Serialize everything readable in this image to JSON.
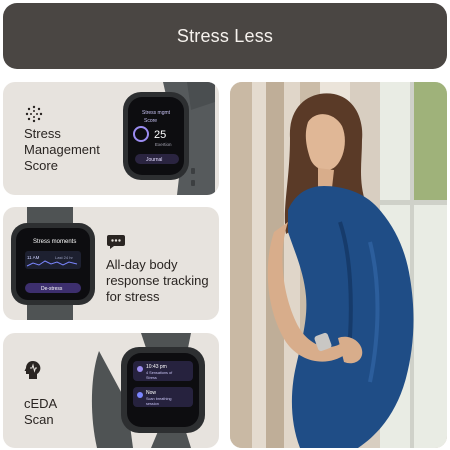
{
  "banner": {
    "title": "Stress Less"
  },
  "features": [
    {
      "label_lines": [
        "Stress",
        "Management",
        "Score"
      ],
      "icon": "dotted-circle-icon"
    },
    {
      "label_lines": [
        "All-day body",
        "response tracking",
        "for stress"
      ],
      "icon": "chat-bubble-icon"
    },
    {
      "label_lines": [
        "cEDA",
        "Scan"
      ],
      "icon": "head-pulse-icon"
    }
  ],
  "watch1": {
    "line1": "Stress mgmt",
    "line2": "Score",
    "score": "25",
    "sub": "Exertion",
    "button": "Journal"
  },
  "watch2": {
    "title": "Stress moments",
    "time": "11 AM",
    "range": "Last 24 hr",
    "button": "De-stress"
  },
  "watch3": {
    "time1": "10:43 pm",
    "sub1": "4 Sensations of",
    "sub2": "Stress",
    "time2": "Now",
    "sub3": "Scan breathing",
    "sub4": "session"
  },
  "colors": {
    "banner": "#4a4643",
    "card": "#e7e3de",
    "band": "#4f5354",
    "accent": "#9b8cf0"
  }
}
